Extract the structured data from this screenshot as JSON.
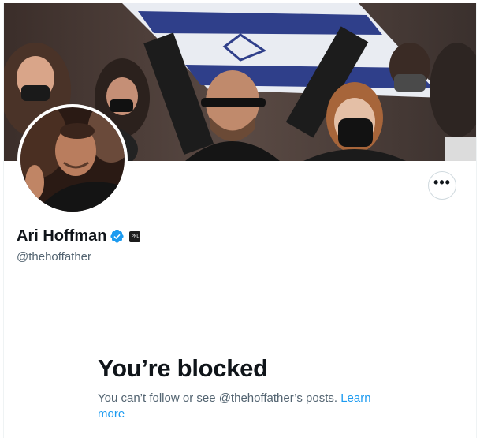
{
  "profile": {
    "display_name": "Ari Hoffman",
    "handle": "@thehoffather",
    "affiliate_badge_text": "PNL",
    "verified_icon": "verified-badge-icon"
  },
  "actions": {
    "more_label": "•••"
  },
  "blocked": {
    "title": "You’re blocked",
    "message": "You can’t follow or see @thehoffather’s posts.",
    "link_label": "Learn more"
  },
  "colors": {
    "accent": "#1d9bf0",
    "text_primary": "#0f1419",
    "text_secondary": "#536471",
    "border": "#cfd9de"
  }
}
